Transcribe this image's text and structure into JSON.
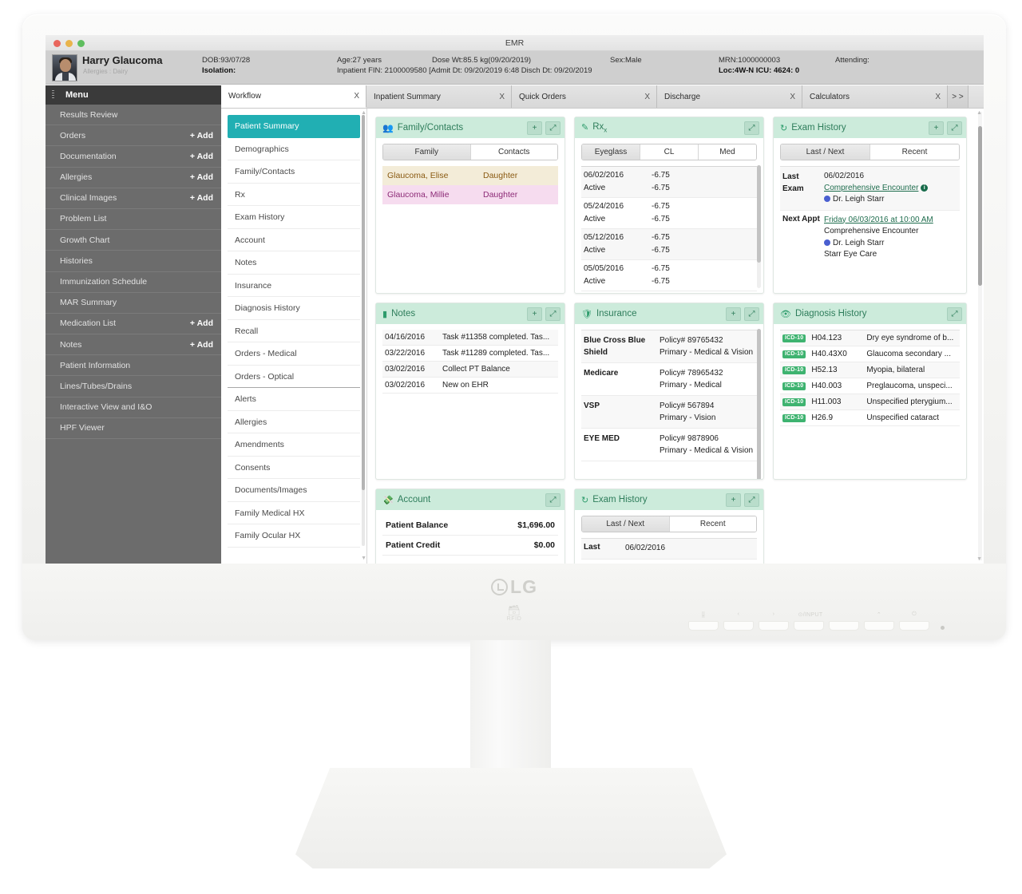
{
  "window": {
    "title": "EMR"
  },
  "banner": {
    "patient_name": "Harry Glaucoma",
    "allergies": "Allergies : Dairy",
    "dob_label": "DOB:93/07/28",
    "isolation_label": "Isolation:",
    "age": "Age:27 years",
    "fin": "Inpatient FIN: 2100009580 [Admit Dt: 09/20/2019 6:48 Disch Dt: 09/20/2019",
    "dose_wt": "Dose Wt:85.5 kg(09/20/2019)",
    "sex": "Sex:Male",
    "mrn": "MRN:1000000003",
    "loc": "Loc:4W-N ICU: 4624: 0",
    "attending": "Attending:"
  },
  "menu": {
    "header": "Menu",
    "items": [
      {
        "label": "Results Review",
        "add": ""
      },
      {
        "label": "Orders",
        "add": "+ Add"
      },
      {
        "label": "Documentation",
        "add": "+ Add"
      },
      {
        "label": "Allergies",
        "add": "+ Add"
      },
      {
        "label": "Clinical Images",
        "add": "+ Add"
      },
      {
        "label": "Problem List",
        "add": ""
      },
      {
        "label": "Growth Chart",
        "add": ""
      },
      {
        "label": "Histories",
        "add": ""
      },
      {
        "label": "Immunization Schedule",
        "add": ""
      },
      {
        "label": "MAR Summary",
        "add": ""
      },
      {
        "label": "Medication List",
        "add": "+ Add"
      },
      {
        "label": "Notes",
        "add": "+ Add"
      },
      {
        "label": "Patient Information",
        "add": ""
      },
      {
        "label": "Lines/Tubes/Drains",
        "add": ""
      },
      {
        "label": "Interactive View and I&O",
        "add": ""
      },
      {
        "label": "HPF Viewer",
        "add": ""
      }
    ]
  },
  "tabs": {
    "items": [
      {
        "label": "Workflow",
        "close": "X",
        "active": true
      },
      {
        "label": "Inpatient Summary",
        "close": "X",
        "active": false
      },
      {
        "label": "Quick Orders",
        "close": "X",
        "active": false
      },
      {
        "label": "Discharge",
        "close": "X",
        "active": false
      },
      {
        "label": "Calculators",
        "close": "X",
        "active": false
      }
    ],
    "more": "> >"
  },
  "workflow_nav": {
    "items": [
      {
        "label": "Patient Summary",
        "active": true
      },
      {
        "label": "Demographics",
        "active": false
      },
      {
        "label": "Family/Contacts",
        "active": false
      },
      {
        "label": "Rx",
        "active": false
      },
      {
        "label": "Exam History",
        "active": false
      },
      {
        "label": "Account",
        "active": false
      },
      {
        "label": "Notes",
        "active": false
      },
      {
        "label": "Insurance",
        "active": false
      },
      {
        "label": "Diagnosis History",
        "active": false
      },
      {
        "label": "Recall",
        "active": false
      },
      {
        "label": "Orders - Medical",
        "active": false
      },
      {
        "label": "Orders - Optical",
        "active": false
      },
      {
        "label": "Alerts",
        "active": false
      },
      {
        "label": "Allergies",
        "active": false
      },
      {
        "label": "Amendments",
        "active": false
      },
      {
        "label": "Consents",
        "active": false
      },
      {
        "label": "Documents/Images",
        "active": false
      },
      {
        "label": "Family Medical HX",
        "active": false
      },
      {
        "label": "Family Ocular HX",
        "active": false
      }
    ]
  },
  "cards": {
    "family_contacts": {
      "title": "Family/Contacts",
      "icon": "people-icon",
      "add_label": "+",
      "expand_label": "⤢",
      "tabs": [
        {
          "label": "Family",
          "on": true
        },
        {
          "label": "Contacts",
          "on": false
        }
      ],
      "rows": [
        {
          "name": "Glaucoma, Elise",
          "relation": "Daughter"
        },
        {
          "name": "Glaucoma, Millie",
          "relation": "Daughter"
        }
      ]
    },
    "rx": {
      "title": "Rx",
      "title_sub": "x",
      "icon": "edit-icon",
      "expand_label": "⤢",
      "tabs": [
        {
          "label": "Eyeglass",
          "on": true
        },
        {
          "label": "CL",
          "on": false
        },
        {
          "label": "Med",
          "on": false
        }
      ],
      "rows": [
        {
          "date": "06/02/2016",
          "status": "Active",
          "od": "-6.75",
          "os": "-6.75"
        },
        {
          "date": "05/24/2016",
          "status": "Active",
          "od": "-6.75",
          "os": "-6.75"
        },
        {
          "date": "05/12/2016",
          "status": "Active",
          "od": "-6.75",
          "os": "-6.75"
        },
        {
          "date": "05/05/2016",
          "status": "Active",
          "od": "-6.75",
          "os": "-6.75"
        }
      ]
    },
    "exam_history_top": {
      "title": "Exam History",
      "icon": "history-icon",
      "add_label": "+",
      "expand_label": "⤢",
      "tabs": [
        {
          "label": "Last / Next",
          "on": true
        },
        {
          "label": "Recent",
          "on": false
        }
      ],
      "last_label": "Last",
      "last_label2": "Exam",
      "last_date": "06/02/2016",
      "last_encounter": "Comprehensive Encounter",
      "last_provider": "Dr. Leigh Starr",
      "next_label": "Next Appt",
      "next_datetime": "Friday 06/03/2016 at 10:00 AM",
      "next_encounter": "Comprehensive Encounter",
      "next_provider": "Dr. Leigh Starr",
      "next_location": "Starr Eye Care"
    },
    "notes": {
      "title": "Notes",
      "icon": "note-icon",
      "add_label": "+",
      "expand_label": "⤢",
      "rows": [
        {
          "date": "04/16/2016",
          "text": "Task #11358 completed. Tas..."
        },
        {
          "date": "03/22/2016",
          "text": "Task #11289 completed. Tas..."
        },
        {
          "date": "03/02/2016",
          "text": "Collect PT Balance"
        },
        {
          "date": "03/02/2016",
          "text": "New on EHR"
        }
      ]
    },
    "insurance": {
      "title": "Insurance",
      "icon": "shield-icon",
      "add_label": "+",
      "expand_label": "⤢",
      "rows": [
        {
          "name": "Blue Cross Blue Shield",
          "policy": "Policy# 89765432",
          "type": "Primary - Medical & Vision"
        },
        {
          "name": "Medicare",
          "policy": "Policy# 78965432",
          "type": "Primary - Medical"
        },
        {
          "name": "VSP",
          "policy": "Policy# 567894",
          "type": "Primary - Vision"
        },
        {
          "name": "EYE MED",
          "policy": "Policy# 9878906",
          "type": "Primary - Medical & Vision"
        }
      ]
    },
    "diagnosis_history": {
      "title": "Diagnosis History",
      "icon": "eye-icon",
      "expand_label": "⤢",
      "badge": "ICD-10",
      "rows": [
        {
          "code": "H04.123",
          "desc": "Dry eye syndrome of b..."
        },
        {
          "code": "H40.43X0",
          "desc": "Glaucoma secondary ..."
        },
        {
          "code": "H52.13",
          "desc": "Myopia, bilateral"
        },
        {
          "code": "H40.003",
          "desc": "Preglaucoma, unspeci..."
        },
        {
          "code": "H11.003",
          "desc": "Unspecified pterygium..."
        },
        {
          "code": "H26.9",
          "desc": "Unspecified cataract"
        }
      ]
    },
    "account": {
      "title": "Account",
      "icon": "money-icon",
      "expand_label": "⤢",
      "rows": [
        {
          "label": "Patient Balance",
          "value": "$1,696.00"
        },
        {
          "label": "Patient Credit",
          "value": "$0.00"
        }
      ]
    },
    "exam_history_bottom": {
      "title": "Exam History",
      "icon": "history-icon",
      "add_label": "+",
      "expand_label": "⤢",
      "tabs": [
        {
          "label": "Last / Next",
          "on": true
        },
        {
          "label": "Recent",
          "on": false
        }
      ],
      "last_label": "Last",
      "last_date": "06/02/2016"
    }
  },
  "monitor": {
    "brand": "LG",
    "rfid_label": "RFID",
    "buttons": [
      {
        "glyph": "⣿",
        "label": ""
      },
      {
        "glyph": "‹",
        "label": ""
      },
      {
        "glyph": "›",
        "label": ""
      },
      {
        "glyph": "⊙/INPUT",
        "label": ""
      },
      {
        "glyph": "⌄",
        "label": ""
      },
      {
        "glyph": "⌃",
        "label": ""
      },
      {
        "glyph": "⏻",
        "label": ""
      }
    ]
  }
}
